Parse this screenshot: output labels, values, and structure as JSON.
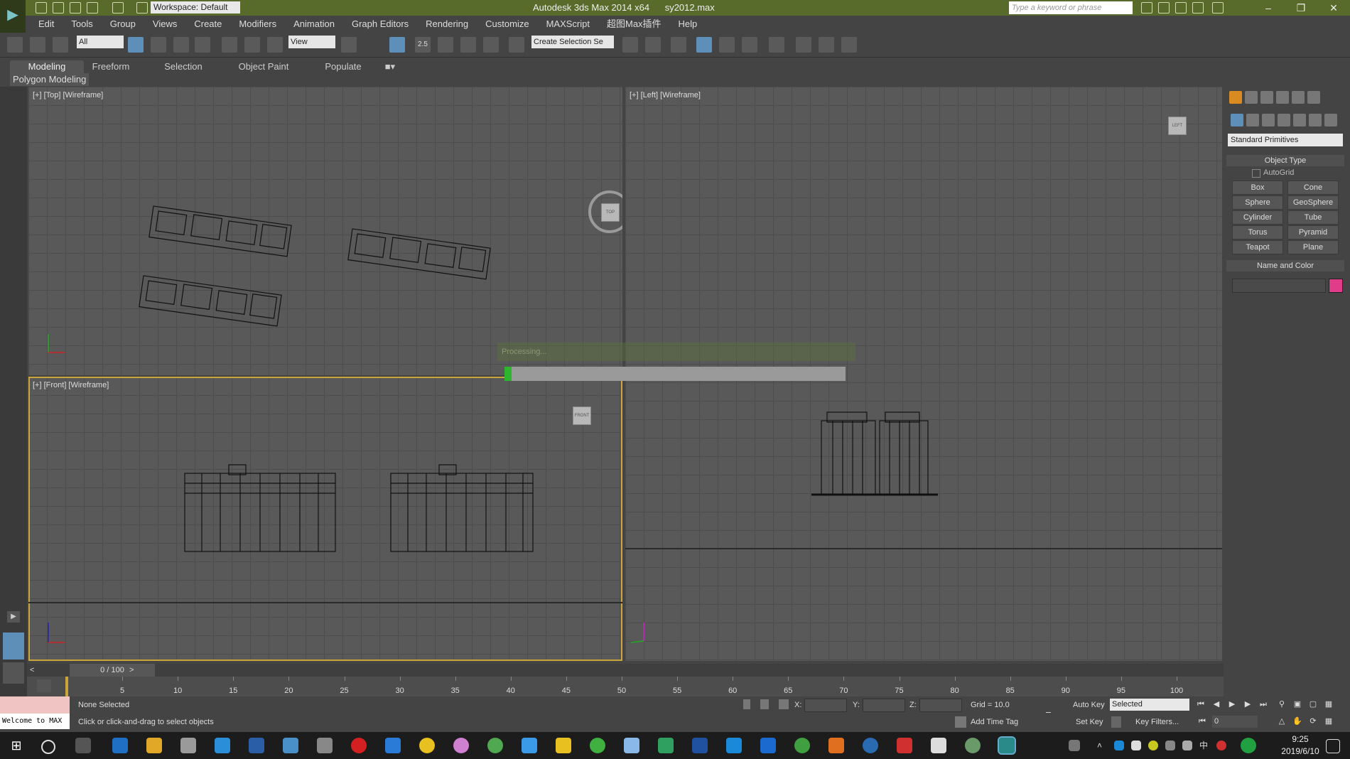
{
  "titlebar": {
    "workspace": "Workspace: Default",
    "app_title": "Autodesk 3ds Max  2014 x64",
    "file_name": "sy2012.max",
    "search_placeholder": "Type a keyword or phrase"
  },
  "menu": [
    "Edit",
    "Tools",
    "Group",
    "Views",
    "Create",
    "Modifiers",
    "Animation",
    "Graph Editors",
    "Rendering",
    "Customize",
    "MAXScript",
    "超图Max插件",
    "Help"
  ],
  "toolbar": {
    "selection_filter": "All",
    "ref_coord": "View",
    "snap_value": "2.5",
    "named_selection": "Create Selection Se"
  },
  "ribbon": {
    "tabs": [
      "Modeling",
      "Freeform",
      "Selection",
      "Object Paint",
      "Populate"
    ],
    "panel_label": "Polygon Modeling"
  },
  "viewports": {
    "top": "[+] [Top] [Wireframe]",
    "left": "[+] [Left] [Wireframe]",
    "front": "[+] [Front] [Wireframe]",
    "cube_top": "TOP",
    "cube_left": "LEFT",
    "cube_front": "FRONT"
  },
  "processing": {
    "label": "Processing...",
    "progress": 0.02
  },
  "command_panel": {
    "category": "Standard Primitives",
    "object_type_title": "Object Type",
    "autogrid": "AutoGrid",
    "buttons": [
      "Box",
      "Cone",
      "Sphere",
      "GeoSphere",
      "Cylinder",
      "Tube",
      "Torus",
      "Pyramid",
      "Teapot",
      "Plane"
    ],
    "name_color_title": "Name and Color",
    "swatch_color": "#e03c8a"
  },
  "timeline": {
    "counter": "0 / 100",
    "prev": "<",
    "next": ">",
    "ticks": [
      "5",
      "10",
      "15",
      "20",
      "25",
      "30",
      "35",
      "40",
      "45",
      "50",
      "55",
      "60",
      "65",
      "70",
      "75",
      "80",
      "85",
      "90",
      "95",
      "100"
    ]
  },
  "status": {
    "welcome": "Welcome to MAX",
    "selection": "None Selected",
    "prompt": "Click or click-and-drag to select objects",
    "x_label": "X:",
    "y_label": "Y:",
    "z_label": "Z:",
    "grid": "Grid = 10.0",
    "auto_key": "Auto Key",
    "auto_key_mode": "Selected",
    "set_key": "Set Key",
    "key_filters": "Key Filters...",
    "add_time_tag": "Add Time Tag",
    "frame": "0"
  },
  "taskbar": {
    "time": "9:25",
    "date": "2019/6/10"
  }
}
